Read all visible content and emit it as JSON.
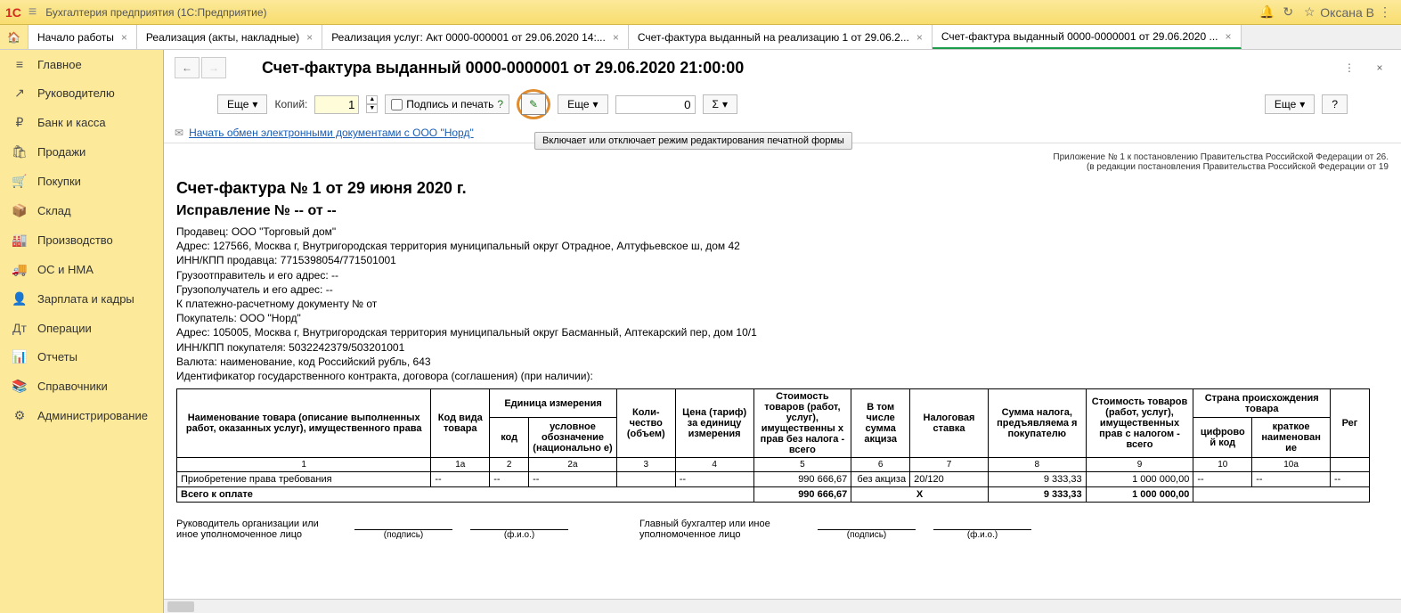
{
  "titlebar": {
    "app_title": "Бухгалтерия предприятия  (1С:Предприятие)",
    "user": "Оксана В"
  },
  "tabs": [
    {
      "label": "Начало работы"
    },
    {
      "label": "Реализация (акты, накладные)"
    },
    {
      "label": "Реализация услуг: Акт 0000-000001 от 29.06.2020 14:..."
    },
    {
      "label": "Счет-фактура выданный на реализацию 1 от 29.06.2..."
    },
    {
      "label": "Счет-фактура выданный 0000-0000001 от 29.06.2020 ...",
      "active": true
    }
  ],
  "sidebar": [
    {
      "icon": "≡",
      "label": "Главное"
    },
    {
      "icon": "↗",
      "label": "Руководителю"
    },
    {
      "icon": "₽",
      "label": "Банк и касса"
    },
    {
      "icon": "🛍",
      "label": "Продажи"
    },
    {
      "icon": "🛒",
      "label": "Покупки"
    },
    {
      "icon": "📦",
      "label": "Склад"
    },
    {
      "icon": "🏭",
      "label": "Производство"
    },
    {
      "icon": "🚚",
      "label": "ОС и НМА"
    },
    {
      "icon": "👤",
      "label": "Зарплата и кадры"
    },
    {
      "icon": "Дт",
      "label": "Операции"
    },
    {
      "icon": "📊",
      "label": "Отчеты"
    },
    {
      "icon": "📚",
      "label": "Справочники"
    },
    {
      "icon": "⚙",
      "label": "Администрирование"
    }
  ],
  "doc": {
    "title": "Счет-фактура выданный 0000-0000001 от 29.06.2020 21:00:00"
  },
  "toolbar": {
    "more": "Еще",
    "copies_label": "Копий:",
    "copies_value": "1",
    "sign_print": "Подпись и печать",
    "help": "?",
    "zero": "0",
    "sigma": "Σ"
  },
  "tooltip": "Включает или отключает режим редактирования печатной формы",
  "link": "Начать обмен электронными документами с ООО \"Норд\"",
  "appendix": {
    "line1": "Приложение № 1 к постановлению Правительства Российской Федерации от 26.",
    "line2": "(в редакции постановления Правительства Российской Федерации от 19"
  },
  "invoice": {
    "h2": "Счет-фактура № 1 от 29 июня 2020 г.",
    "h3": "Исправление № -- от --",
    "lines": [
      "Продавец: ООО \"Торговый дом\"",
      "Адрес: 127566, Москва г, Внутригородская территория муниципальный округ Отрадное, Алтуфьевское ш, дом 42",
      "ИНН/КПП продавца: 7715398054/771501001",
      "Грузоотправитель и его адрес: --",
      "Грузополучатель и его адрес: --",
      "К платежно-расчетному документу № от",
      "Покупатель: ООО \"Норд\"",
      "Адрес: 105005, Москва г, Внутригородская территория муниципальный округ Басманный, Аптекарский пер, дом 10/1",
      "ИНН/КПП покупателя: 5032242379/503201001",
      "Валюта: наименование, код Российский рубль, 643",
      "Идентификатор государственного контракта, договора (соглашения) (при наличии):"
    ]
  },
  "table": {
    "headers": {
      "name": "Наименование товара (описание выполненных работ, оказанных услуг), имущественного права",
      "code_type": "Код вида товара",
      "unit": "Единица измерения",
      "unit_code": "код",
      "unit_name": "условное обозначение (национально е)",
      "qty": "Коли-чество (объем)",
      "price": "Цена (тариф) за единицу измерения",
      "cost_notax": "Стоимость товаров (работ, услуг), имущественны х прав без налога - всего",
      "excise": "В том числе сумма акциза",
      "tax_rate": "Налоговая ставка",
      "tax_sum": "Сумма налога, предъявляема я покупателю",
      "cost_tax": "Стоимость товаров (работ, услуг), имущественных прав с налогом - всего",
      "country": "Страна происхождения товара",
      "country_code": "цифрово й код",
      "country_name": "краткое наименован ие",
      "reg": "Рег"
    },
    "nums": [
      "1",
      "1а",
      "2",
      "2а",
      "3",
      "4",
      "5",
      "6",
      "7",
      "8",
      "9",
      "10",
      "10а"
    ],
    "row": {
      "name": "Приобретение права требования",
      "code_type": "--",
      "unit_code": "--",
      "unit_name": "--",
      "qty": "",
      "price": "--",
      "cost_notax": "990 666,67",
      "excise": "без акциза",
      "tax_rate": "20/120",
      "tax_sum": "9 333,33",
      "cost_tax": "1 000 000,00",
      "country_code": "--",
      "country_name": "--",
      "reg": "--"
    },
    "total": {
      "label": "Всего к оплате",
      "cost_notax": "990 666,67",
      "excise": "Х",
      "tax_sum": "9 333,33",
      "cost_tax": "1 000 000,00"
    }
  },
  "signatures": {
    "head_label": "Руководитель организации или иное уполномоченное лицо",
    "accountant_label": "Главный бухгалтер или иное уполномоченное лицо",
    "sign_caption": "(подпись)",
    "fio_caption": "(ф.и.о.)"
  }
}
